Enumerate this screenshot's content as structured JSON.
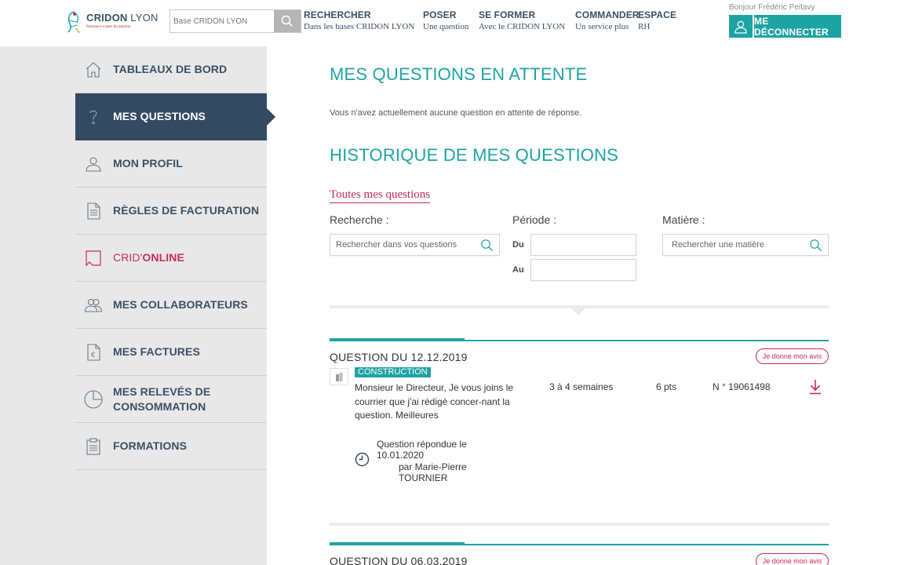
{
  "header": {
    "logo": {
      "name_bold": "CRIDON",
      "name_light": " LYON",
      "tagline": "Puissance expert du notariat"
    },
    "search": {
      "placeholder": "Base CRIDON LYON"
    },
    "nav": [
      {
        "title": "RECHERCHER",
        "subtitle": "Dans les bases CRIDON LYON"
      },
      {
        "title": "POSER",
        "subtitle": "Une question"
      },
      {
        "title": "SE FORMER",
        "subtitle": "Avec le CRIDON LYON"
      },
      {
        "title": "COMMANDER",
        "subtitle": "Un service plus"
      },
      {
        "title": "ESPACE",
        "subtitle": "RH"
      }
    ],
    "greeting": "Bonjour Frédéric Peitavy",
    "logout_label": "ME DÉCONNECTER"
  },
  "sidebar": {
    "items": [
      {
        "label": "TABLEAUX DE BORD",
        "icon": "home-icon"
      },
      {
        "label": "MES QUESTIONS",
        "icon": "question-icon",
        "active": true
      },
      {
        "label": "MON PROFIL",
        "icon": "user-icon"
      },
      {
        "label": "RÈGLES DE FACTURATION",
        "icon": "document-icon"
      },
      {
        "label_a": "CRID'",
        "label_b": "ONLINE",
        "icon": "crid-online-icon"
      },
      {
        "label": "MES COLLABORATEURS",
        "icon": "users-icon"
      },
      {
        "label": "MES FACTURES",
        "icon": "invoice-euro-icon"
      },
      {
        "label": "MES RELEVÉS DE CONSOMMATION",
        "label_line1": "MES RELEVÉS DE",
        "label_line2": "CONSOMMATION",
        "icon": "pie-chart-icon"
      },
      {
        "label": "FORMATIONS",
        "icon": "clipboard-icon"
      }
    ]
  },
  "main": {
    "pending_title": "MES QUESTIONS EN ATTENTE",
    "pending_empty": "Vous n'avez actuellement aucune question en attente de réponse.",
    "history_title": "HISTORIQUE DE MES QUESTIONS",
    "all_link": "Toutes mes questions",
    "filters": {
      "search_label": "Recherche :",
      "search_placeholder": "Rechercher dans vos questions",
      "period_label": "Période :",
      "from_label": "Du",
      "to_label": "Au",
      "from_value": "",
      "to_value": "",
      "subject_label": "Matière :",
      "subject_placeholder": "Rechercher une matière"
    },
    "questions": [
      {
        "title": "QUESTION DU 12.12.2019",
        "feedback_label": "Je donne mon avis",
        "category": "CONSTRUCTION",
        "text": "Monsieur le Directeur, Je vous joins le courrier que j'ai rédigé concer-nant la question. Meilleures",
        "delay": "3 à 4 semaines",
        "points": "6 pts",
        "number": "N ° 19061498",
        "answered_line1": "Question répondue le",
        "answered_date": "10.01.2020",
        "answered_by_line1": "par Marie-Pierre",
        "answered_by_line2": "TOURNIER"
      },
      {
        "title": "QUESTION DU 06.03.2019",
        "feedback_label": "Je donne mon avis"
      }
    ]
  },
  "colors": {
    "teal": "#1ea3a3",
    "navy": "#344a62",
    "crimson": "#c62d52",
    "sidebar_bg": "#e8e8e8"
  }
}
